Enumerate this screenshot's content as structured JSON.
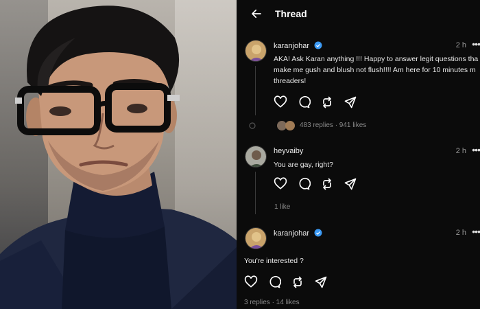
{
  "header": {
    "title": "Thread"
  },
  "posts": [
    {
      "username": "karanjohar",
      "time": "2 h",
      "more": "•••",
      "lines": [
        "AKA! Ask Karan anything !!! Happy to answer legit questions tha",
        "make me gush and blush not flush!!!! Am here for 10 minutes m",
        "threaders!"
      ],
      "stats": "483 replies · 941 likes"
    },
    {
      "username": "heyvaiby",
      "time": "2 h",
      "more": "•••",
      "lines": [
        "You are gay, right?"
      ],
      "stats": "1 like"
    },
    {
      "username": "karanjohar",
      "time": "2 h",
      "more": "•••",
      "lines": [
        "You're interested ?"
      ],
      "stats": "3 replies · 14 likes"
    }
  ],
  "colors": {
    "background": "#0b0b0b",
    "verified": "#3b9af5",
    "muted": "#8a8a8a"
  },
  "icons": [
    "back-arrow-icon",
    "verified-icon",
    "heart-icon",
    "comment-icon",
    "repost-icon",
    "share-icon"
  ]
}
